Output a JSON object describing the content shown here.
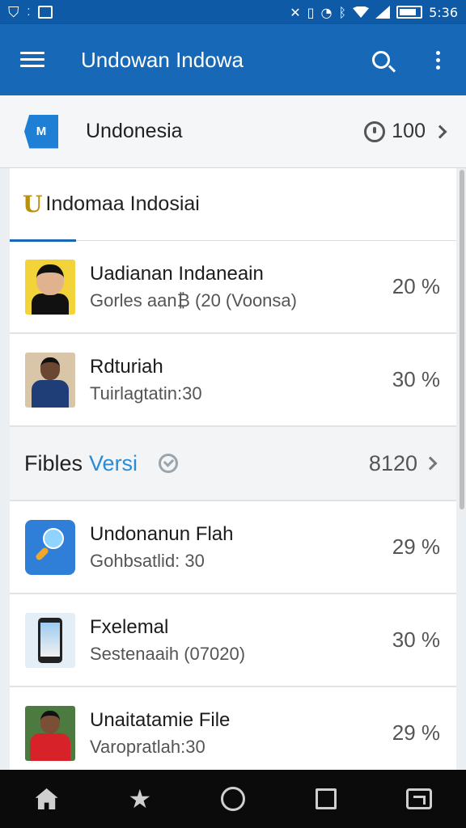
{
  "status_bar": {
    "time": "5:36",
    "icons": [
      "shield-icon",
      "dots-icon",
      "image-icon",
      "mute-icon",
      "vibrate-icon",
      "alarm-icon",
      "bluetooth-icon",
      "wifi-icon",
      "signal-icon",
      "battery-icon"
    ]
  },
  "app_bar": {
    "title": "Undowan Indowa"
  },
  "header": {
    "logo_text": "M",
    "title": "Undonesia",
    "count": "100"
  },
  "section": {
    "logo_letter": "U",
    "title": "Indomaa Indosiai"
  },
  "items_top": [
    {
      "title": "Uadianan Indaneain",
      "subtitle": "Gorles aan₿ (20 (Voonsa)",
      "percent": "20 %",
      "thumb": "person-black-shirt"
    },
    {
      "title": "Rdturiah",
      "subtitle": "Tuirlagtatin:30",
      "percent": "30 %",
      "thumb": "person-blue-shirt"
    }
  ],
  "group": {
    "label": "Fibles",
    "link": "Versi",
    "count": "8120"
  },
  "items_bottom": [
    {
      "title": "Undonanun Flah",
      "subtitle": "Gohbsatlid: 30",
      "percent": "29 %",
      "thumb": "app-icon"
    },
    {
      "title": "Fxelemal",
      "subtitle": "Sestenaaih (07020)",
      "percent": "30 %",
      "thumb": "phone-image"
    },
    {
      "title": "Unaitatamie File",
      "subtitle": "Varopratlah:30",
      "percent": "29 %",
      "thumb": "person-red-shirt"
    }
  ],
  "nav": [
    "home-icon",
    "star-icon",
    "circle-icon",
    "square-icon",
    "recent-icon"
  ]
}
